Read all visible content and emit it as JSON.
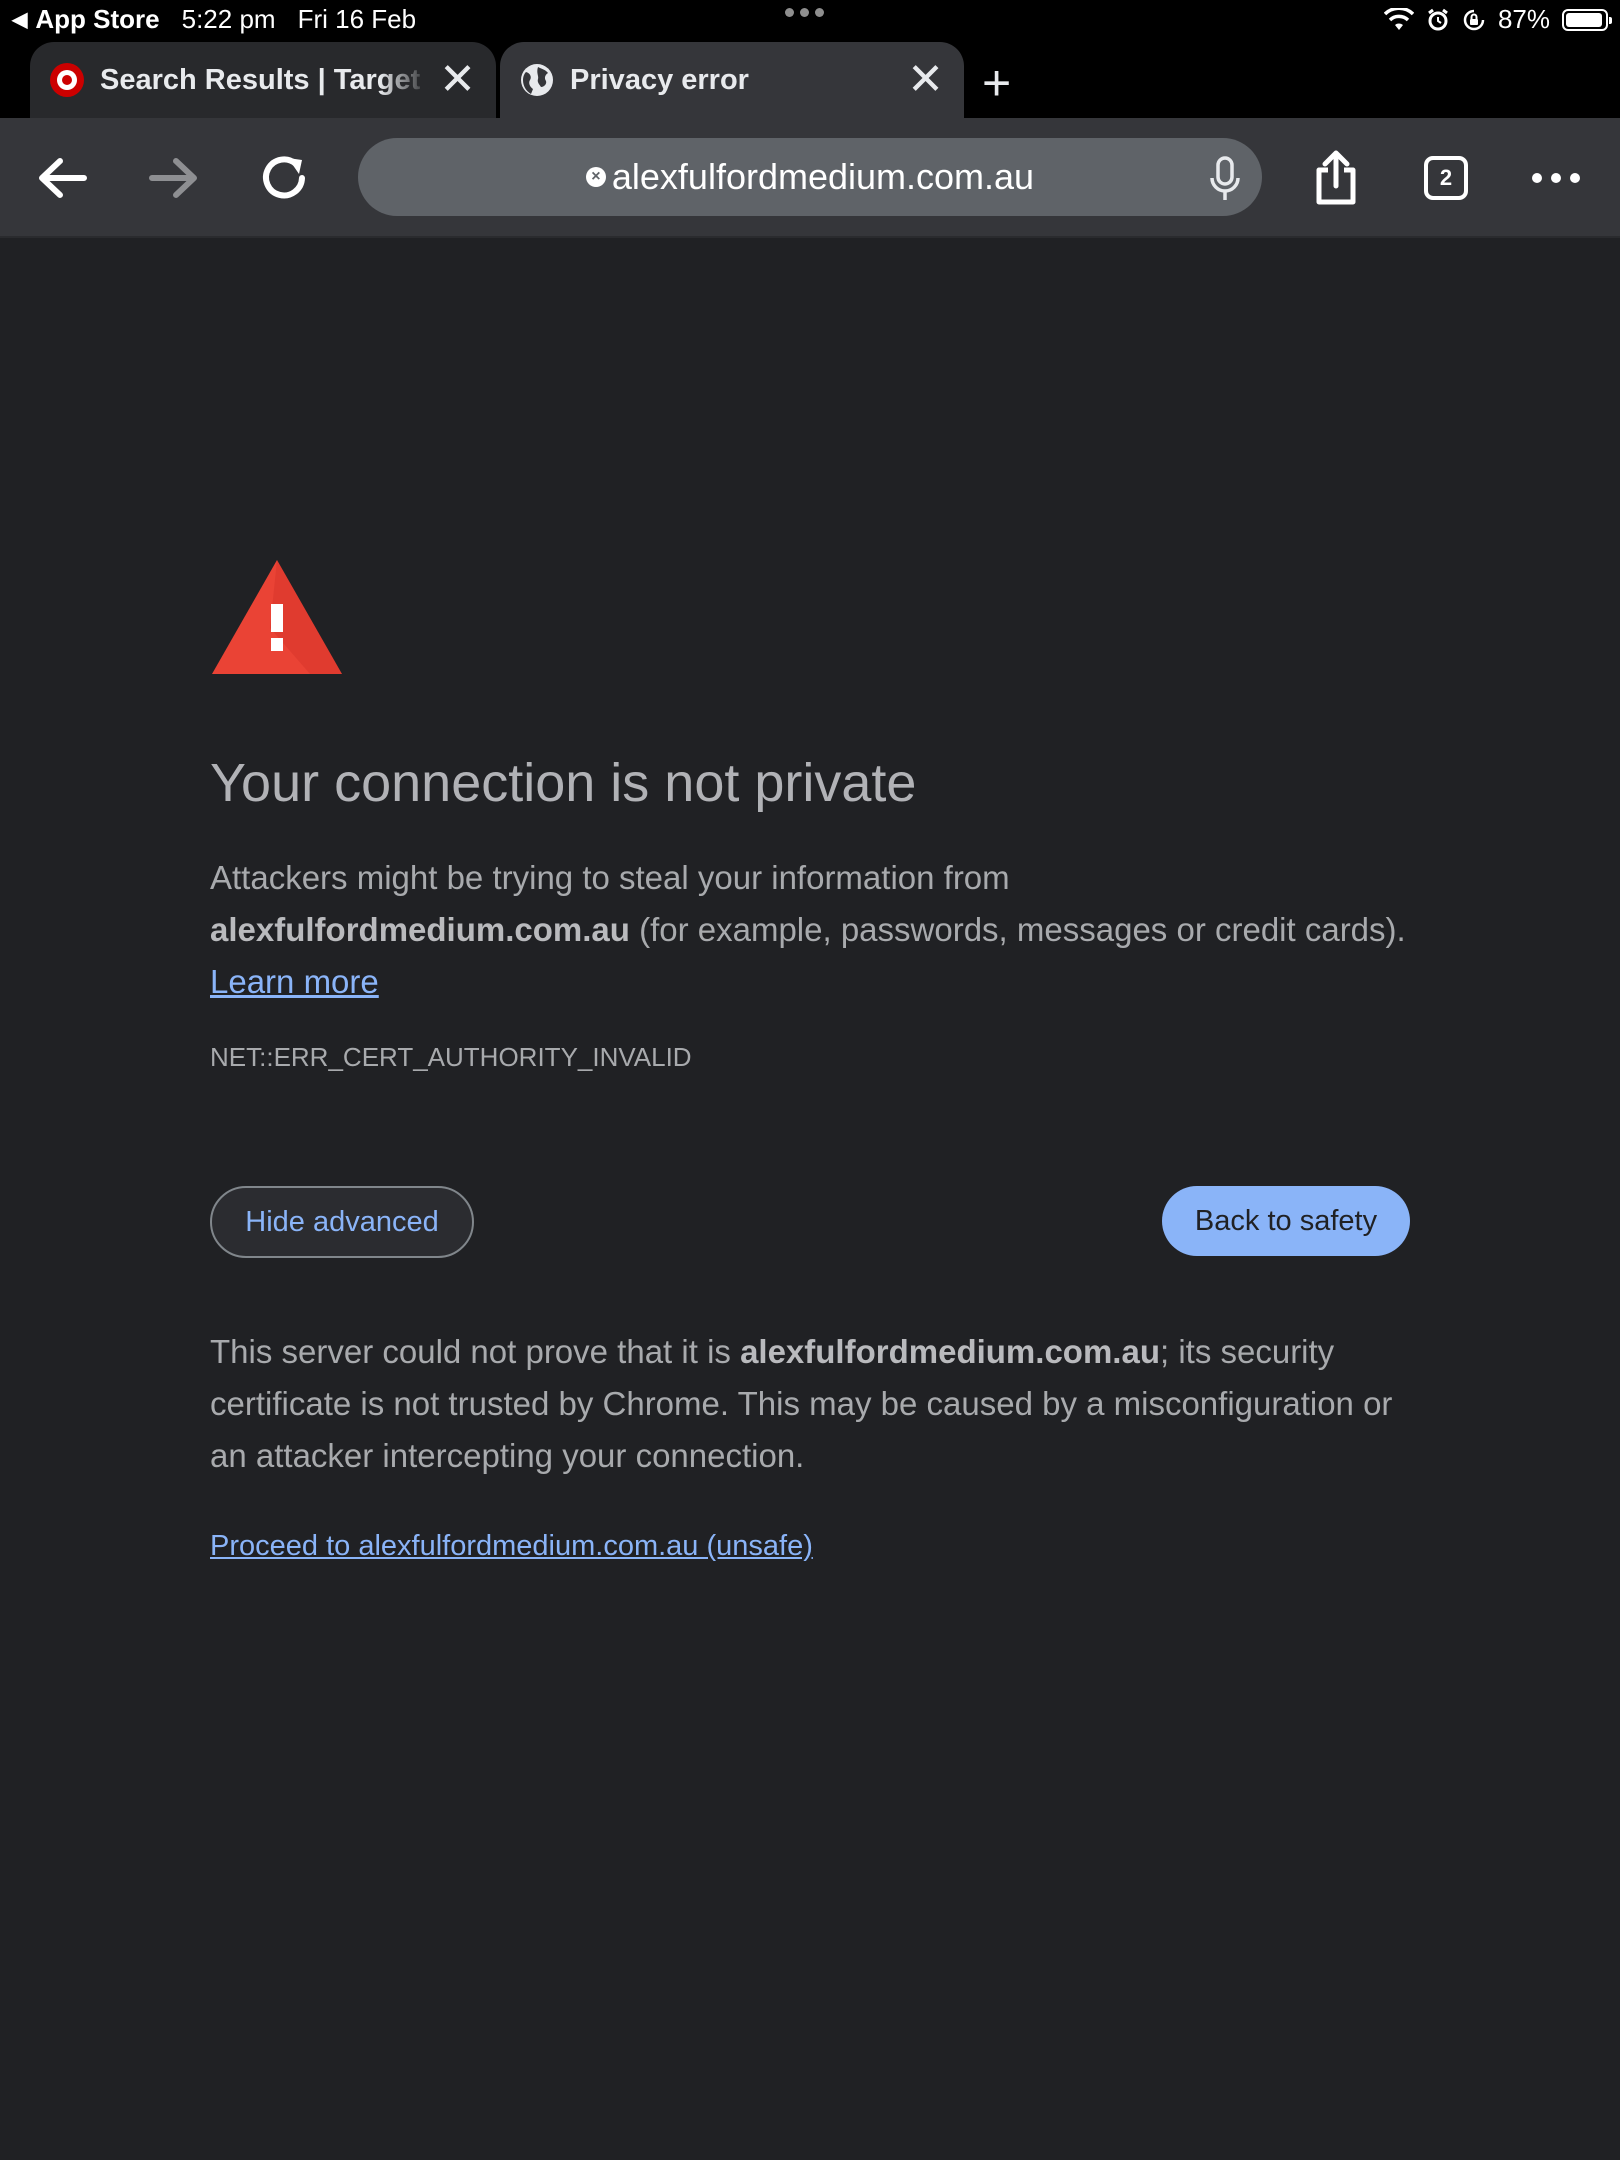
{
  "status_bar": {
    "back_app": "App Store",
    "time": "5:22 pm",
    "date": "Fri 16 Feb",
    "battery": "87%"
  },
  "tabs": [
    {
      "title": "Search Results | Target Australia",
      "icon": "target-logo-icon"
    },
    {
      "title": "Privacy error",
      "icon": "globe-icon"
    }
  ],
  "toolbar": {
    "url": "alexfulfordmedium.com.au",
    "tab_count": "2"
  },
  "page": {
    "heading": "Your connection is not private",
    "intro_prefix": "Attackers might be trying to steal your information from ",
    "domain": "alexfulfordmedium.com.au",
    "intro_suffix": " (for example, passwords, messages or credit cards). ",
    "learn_more": "Learn more",
    "error_code": "NET::ERR_CERT_AUTHORITY_INVALID",
    "hide_advanced": "Hide advanced",
    "back_to_safety": "Back to safety",
    "advanced_prefix": "This server could not prove that it is ",
    "advanced_suffix": "; its security certificate is not trusted by Chrome. This may be caused by a misconfiguration or an attacker intercepting your connection.",
    "proceed_link": "Proceed to alexfulfordmedium.com.au (unsafe)"
  },
  "colors": {
    "background": "#202124",
    "link": "#8ab4f8",
    "warning": "#ea4335"
  }
}
